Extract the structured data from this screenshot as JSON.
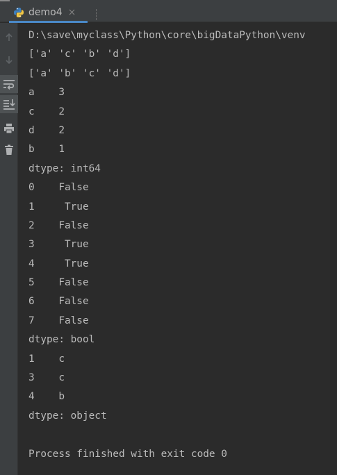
{
  "tab": {
    "label": "demo4",
    "close_glyph": "×",
    "icon": "python-file-icon"
  },
  "toolbar": {
    "tools": [
      "arrow-up-icon",
      "arrow-down-icon",
      "soft-wrap-icon",
      "scroll-to-end-icon",
      "print-icon",
      "trash-icon"
    ]
  },
  "console": {
    "lines": [
      "D:\\save\\myclass\\Python\\core\\bigDataPython\\venv",
      "['a' 'c' 'b' 'd']",
      "['a' 'b' 'c' 'd']",
      "a    3",
      "c    2",
      "d    2",
      "b    1",
      "dtype: int64",
      "0    False",
      "1     True",
      "2    False",
      "3     True",
      "4     True",
      "5    False",
      "6    False",
      "7    False",
      "dtype: bool",
      "1    c",
      "3    c",
      "4    b",
      "dtype: object",
      "",
      "Process finished with exit code 0"
    ]
  }
}
